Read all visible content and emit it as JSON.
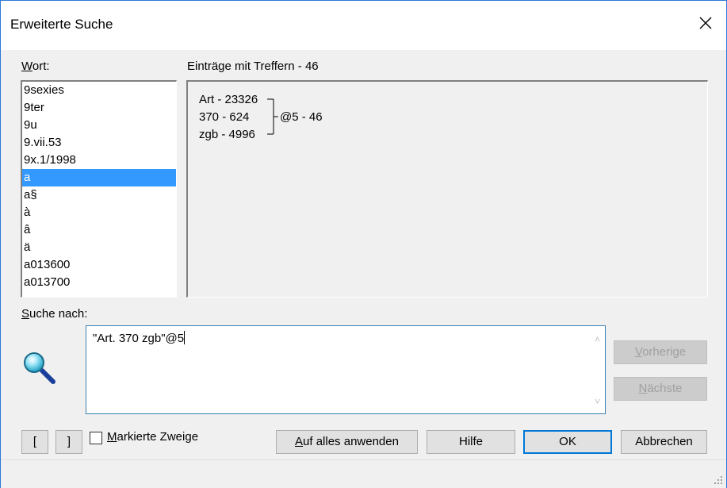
{
  "window": {
    "title": "Erweiterte Suche"
  },
  "word_list": {
    "label_prefix": "",
    "label_underline": "W",
    "label_rest": "ort:",
    "items": [
      "9sexies",
      "9ter",
      "9u",
      "9.vii.53",
      "9x.1/1998",
      "a",
      "a§",
      "à",
      "â",
      "ä",
      "a013600",
      "a013700"
    ],
    "selected_index": 5
  },
  "results": {
    "label": "Einträge mit Treffern - 46",
    "lines": [
      "Art - 23326",
      "370 - 624",
      "zgb - 4996"
    ],
    "combined": "@5 - 46"
  },
  "search": {
    "label_underline": "S",
    "label_rest": "uche nach:",
    "query": "\"Art. 370 zgb\"@5"
  },
  "buttons": {
    "previous_underline": "V",
    "previous_rest": "orherige",
    "next_underline": "N",
    "next_rest": "ächste",
    "bracket_open": "[",
    "bracket_close": "]",
    "apply_all_underline": "A",
    "apply_all_rest": "uf alles anwenden",
    "help": "Hilfe",
    "ok": "OK",
    "cancel": "Abbrechen"
  },
  "checkbox": {
    "label_underline": "M",
    "label_rest": "arkierte Zweige",
    "checked": false
  },
  "icons": {
    "search": "magnifier-icon",
    "close": "close-icon"
  }
}
